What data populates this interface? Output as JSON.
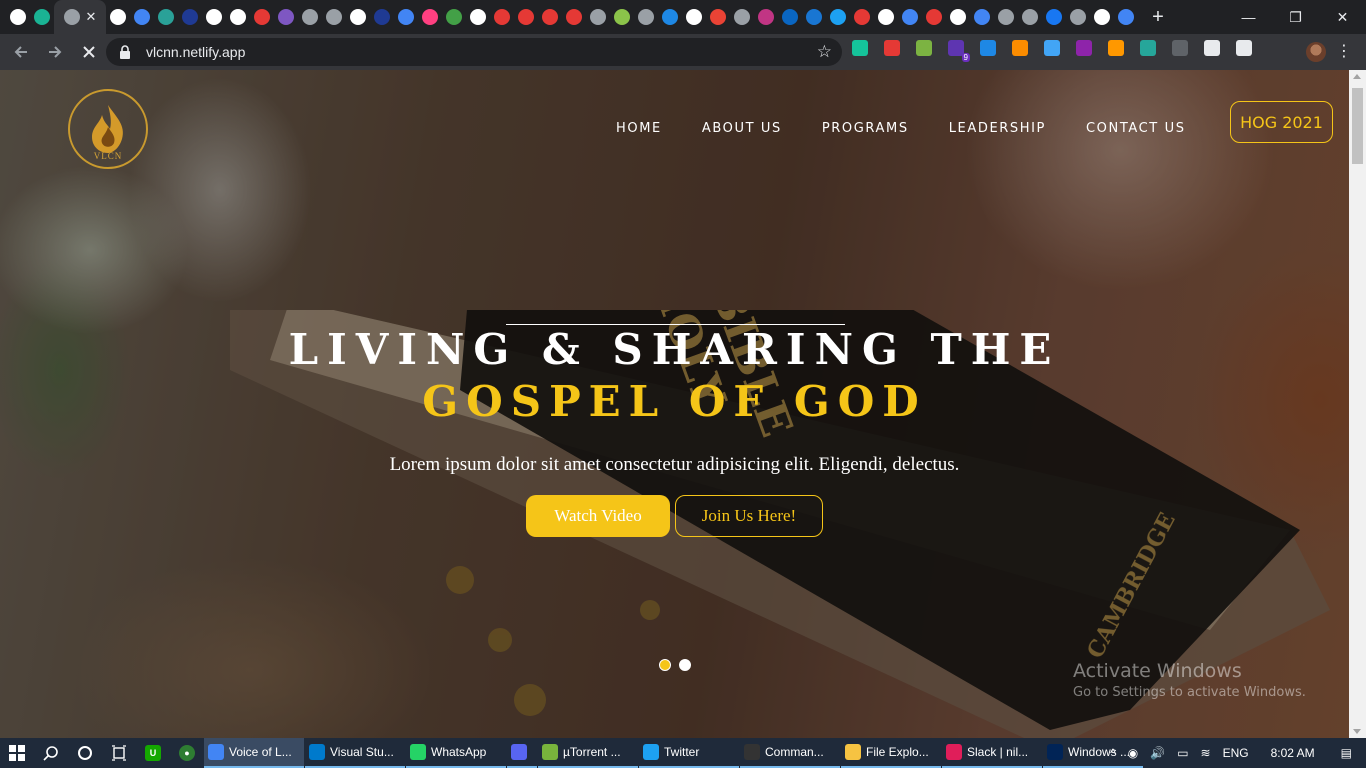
{
  "browser": {
    "window_controls": {
      "minimize": "—",
      "maximize": "❐",
      "close": "✕"
    },
    "tabs": [
      {
        "icon": "github-icon",
        "color": "#ffffff"
      },
      {
        "icon": "diamond-icon",
        "color": "#1ab394"
      },
      {
        "icon": "globe-icon",
        "color": "#9aa0a6"
      },
      {
        "icon": "github-icon",
        "color": "#ffffff"
      },
      {
        "icon": "google-icon",
        "color": "#4285f4"
      },
      {
        "icon": "x-icon",
        "color": "#2aa198"
      },
      {
        "icon": "b-icon",
        "color": "#1f3a93"
      },
      {
        "icon": "github-icon",
        "color": "#ffffff"
      },
      {
        "icon": "github-icon",
        "color": "#ffffff"
      },
      {
        "icon": "red-square-icon",
        "color": "#e53935"
      },
      {
        "icon": "person-icon",
        "color": "#7e57c2"
      },
      {
        "icon": "globe-icon",
        "color": "#9aa0a6"
      },
      {
        "icon": "globe-icon",
        "color": "#9aa0a6"
      },
      {
        "icon": "github-icon",
        "color": "#ffffff"
      },
      {
        "icon": "b-icon",
        "color": "#1f3a93"
      },
      {
        "icon": "google-icon",
        "color": "#4285f4"
      },
      {
        "icon": "swirl-icon",
        "color": "#ff4081"
      },
      {
        "icon": "plus-square-icon",
        "color": "#43a047"
      },
      {
        "icon": "chart-icon",
        "color": "#ffffff"
      },
      {
        "icon": "a-icon",
        "color": "#e53935"
      },
      {
        "icon": "a-icon",
        "color": "#e53935"
      },
      {
        "icon": "a-icon",
        "color": "#e53935"
      },
      {
        "icon": "a-icon",
        "color": "#e53935"
      },
      {
        "icon": "globe-icon",
        "color": "#9aa0a6"
      },
      {
        "icon": "s-icon",
        "color": "#8bc34a"
      },
      {
        "icon": "globe-icon",
        "color": "#9aa0a6"
      },
      {
        "icon": "bluetooth-icon",
        "color": "#1e88e5"
      },
      {
        "icon": "n-icon",
        "color": "#ffffff"
      },
      {
        "icon": "gmail-icon",
        "color": "#ea4335"
      },
      {
        "icon": "globe-icon",
        "color": "#9aa0a6"
      },
      {
        "icon": "instagram-icon",
        "color": "#c13584"
      },
      {
        "icon": "linkedin-icon",
        "color": "#0a66c2"
      },
      {
        "icon": "infinity-icon",
        "color": "#1976d2"
      },
      {
        "icon": "twitter-icon",
        "color": "#1da1f2"
      },
      {
        "icon": "opera-icon",
        "color": "#e53935"
      },
      {
        "icon": "github-icon",
        "color": "#ffffff"
      },
      {
        "icon": "google-icon",
        "color": "#4285f4"
      },
      {
        "icon": "opera-icon",
        "color": "#e53935"
      },
      {
        "icon": "github-icon",
        "color": "#ffffff"
      },
      {
        "icon": "google-icon",
        "color": "#4285f4"
      },
      {
        "icon": "globe-icon",
        "color": "#9aa0a6"
      },
      {
        "icon": "globe-icon",
        "color": "#9aa0a6"
      },
      {
        "icon": "facebook-icon",
        "color": "#1877f2"
      },
      {
        "icon": "globe-icon",
        "color": "#9aa0a6"
      },
      {
        "icon": "chart-icon",
        "color": "#ffffff"
      },
      {
        "icon": "docs-icon",
        "color": "#4285f4"
      }
    ],
    "url": "vlcnn.netlify.app",
    "extensions": [
      {
        "icon": "grammarly-icon",
        "color": "#15c39a"
      },
      {
        "icon": "play-icon",
        "color": "#e53935"
      },
      {
        "icon": "tree-icon",
        "color": "#7cb342"
      },
      {
        "icon": "badge-ext-icon",
        "color": "#5e35b1",
        "badge": "9"
      },
      {
        "icon": "shield-ext-icon",
        "color": "#1e88e5"
      },
      {
        "icon": "stack-icon",
        "color": "#fb8c00"
      },
      {
        "icon": "search-ext-icon",
        "color": "#42a5f5"
      },
      {
        "icon": "circle-ext-icon",
        "color": "#8e24aa"
      },
      {
        "icon": "wave-icon",
        "color": "#ff9800"
      },
      {
        "icon": "vpn-icon",
        "color": "#26a69a"
      },
      {
        "icon": "download-ext-icon",
        "color": "#5f6368"
      },
      {
        "icon": "puzzle-icon",
        "color": "#e8eaed"
      },
      {
        "icon": "queue-icon",
        "color": "#e8eaed"
      }
    ]
  },
  "site": {
    "logo_text": "VLCN",
    "nav": [
      "HOME",
      "ABOUT US",
      "PROGRAMS",
      "LEADERSHIP",
      "CONTACT US"
    ],
    "cta_button": "HOG 2021",
    "hero": {
      "title_line1": "LIVING & SHARING THE",
      "title_line2": "GOSPEL OF GOD",
      "subtitle": "Lorem ipsum dolor sit amet consectetur adipisicing elit. Eligendi, delectus.",
      "primary_button": "Watch Video",
      "secondary_button": "Join Us Here!",
      "slides": 2,
      "active_slide": 1
    },
    "colors": {
      "accent": "#f5c518",
      "text": "#ffffff"
    }
  },
  "watermark": {
    "title": "Activate Windows",
    "subtitle": "Go to Settings to activate Windows."
  },
  "taskbar": {
    "apps": [
      {
        "label": "Voice of L...",
        "icon_color": "#4285f4",
        "active": true
      },
      {
        "label": "Visual Stu...",
        "icon_color": "#007acc",
        "active": false
      },
      {
        "label": "WhatsApp",
        "icon_color": "#25d366",
        "active": false
      },
      {
        "label": "",
        "icon_color": "#5865f2",
        "active": false
      },
      {
        "label": "µTorrent ...",
        "icon_color": "#78b33c",
        "active": false
      },
      {
        "label": "Twitter",
        "icon_color": "#1da1f2",
        "active": false
      },
      {
        "label": "Comman...",
        "icon_color": "#333333",
        "active": false
      },
      {
        "label": "File Explo...",
        "icon_color": "#f6c342",
        "active": false
      },
      {
        "label": "Slack | nil...",
        "icon_color": "#e01e5a",
        "active": false
      },
      {
        "label": "Windows ...",
        "icon_color": "#012456",
        "active": false
      }
    ],
    "tray": {
      "language": "ENG",
      "time": "8:02 AM"
    }
  }
}
